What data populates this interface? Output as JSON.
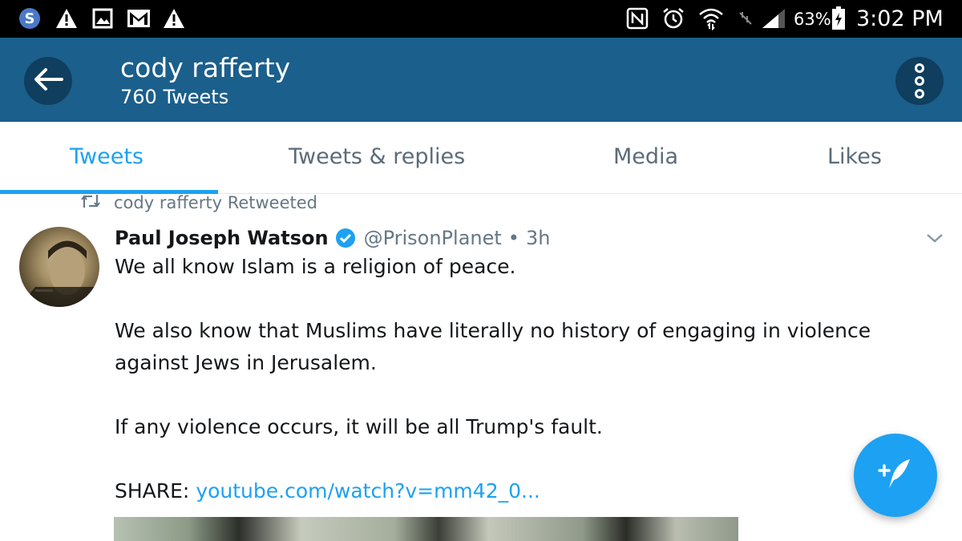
{
  "status_bar": {
    "left_icons": [
      "s-app-icon",
      "warning-icon",
      "image-icon",
      "gmail-icon",
      "warning-icon"
    ],
    "right_icons": [
      "nfc-icon",
      "alarm-icon",
      "wifi-icon",
      "signal-icon",
      "battery-icon"
    ],
    "battery": "63%",
    "time": "3:02 PM"
  },
  "header": {
    "title": "cody rafferty",
    "subtitle": "760 Tweets",
    "back_icon": "arrow-left-icon",
    "more_icon": "more-vertical-icon"
  },
  "tabs": [
    {
      "label": "Tweets",
      "active": true
    },
    {
      "label": "Tweets & replies",
      "active": false
    },
    {
      "label": "Media",
      "active": false
    },
    {
      "label": "Likes",
      "active": false
    }
  ],
  "tweet": {
    "retweet_label": "cody rafferty Retweeted",
    "author": "Paul Joseph Watson",
    "verified": true,
    "handle": "@PrisonPlanet",
    "separator": "•",
    "time": "3h",
    "lines": [
      "We all know Islam is a religion of peace.",
      "We also know that Muslims have literally no history of engaging in violence",
      "against Jews in Jerusalem.",
      "If any violence occurs, it will be all Trump's fault."
    ],
    "share_label": "SHARE:",
    "share_link": "youtube.com/watch?v=mm42_0..."
  },
  "fab": {
    "icon": "compose-tweet-icon"
  },
  "colors": {
    "accent": "#1da1f2",
    "header_bg": "#1b5f8c",
    "header_button_bg": "#103e5e",
    "status_bar_bg": "#000000",
    "muted_text": "#657786"
  }
}
